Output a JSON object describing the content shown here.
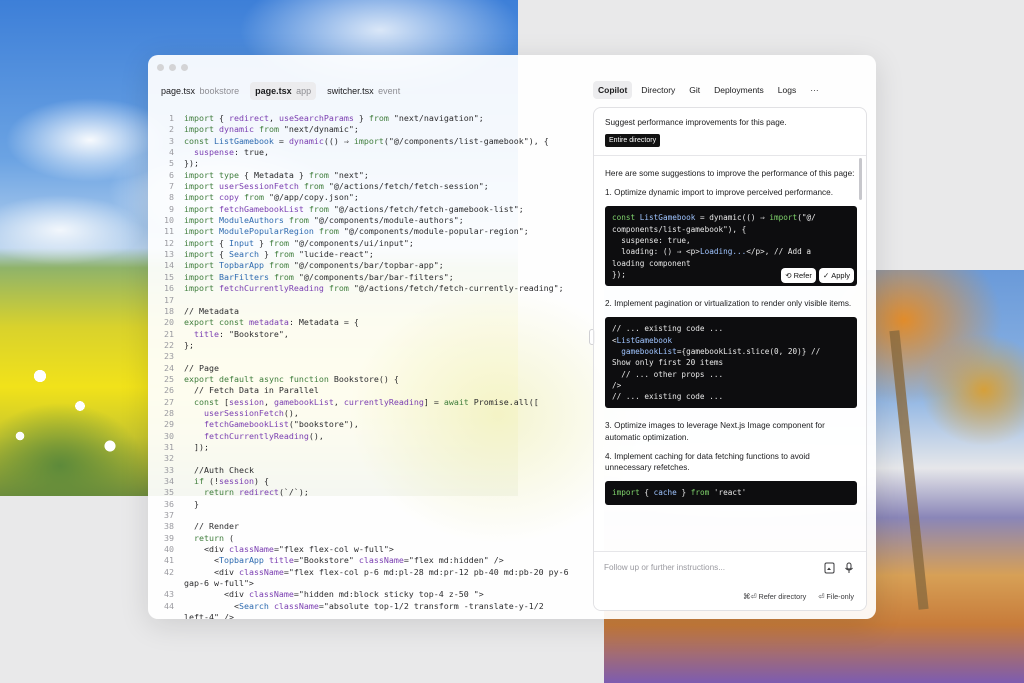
{
  "editor": {
    "tabs": [
      {
        "label": "page.tsx",
        "sub": "bookstore",
        "active": false
      },
      {
        "label": "page.tsx",
        "sub": "app",
        "active": true
      },
      {
        "label": "switcher.tsx",
        "sub": "event",
        "active": false
      }
    ],
    "lines": [
      {
        "n": "1",
        "t": "import { redirect, useSearchParams } from \"next/navigation\";"
      },
      {
        "n": "2",
        "t": "import dynamic from \"next/dynamic\";"
      },
      {
        "n": "3",
        "t": "const ListGamebook = dynamic(() ⇒ import(\"@/components/list-gamebook\"), {"
      },
      {
        "n": "4",
        "t": "  suspense: true,"
      },
      {
        "n": "5",
        "t": "});"
      },
      {
        "n": "6",
        "t": "import type { Metadata } from \"next\";"
      },
      {
        "n": "7",
        "t": "import userSessionFetch from \"@/actions/fetch/fetch-session\";"
      },
      {
        "n": "8",
        "t": "import copy from \"@/app/copy.json\";"
      },
      {
        "n": "9",
        "t": "import fetchGamebookList from \"@/actions/fetch/fetch-gamebook-list\";"
      },
      {
        "n": "10",
        "t": "import ModuleAuthors from \"@/components/module-authors\";"
      },
      {
        "n": "11",
        "t": "import ModulePopularRegion from \"@/components/module-popular-region\";"
      },
      {
        "n": "12",
        "t": "import { Input } from \"@/components/ui/input\";"
      },
      {
        "n": "13",
        "t": "import { Search } from \"lucide-react\";"
      },
      {
        "n": "14",
        "t": "import TopbarApp from \"@/components/bar/topbar-app\";"
      },
      {
        "n": "15",
        "t": "import BarFilters from \"@/components/bar/bar-filters\";"
      },
      {
        "n": "16",
        "t": "import fetchCurrentlyReading from \"@/actions/fetch/fetch-currently-reading\";"
      },
      {
        "n": "17",
        "t": ""
      },
      {
        "n": "18",
        "t": "// Metadata"
      },
      {
        "n": "20",
        "t": "export const metadata: Metadata = {"
      },
      {
        "n": "21",
        "t": "  title: \"Bookstore\","
      },
      {
        "n": "22",
        "t": "};"
      },
      {
        "n": "23",
        "t": ""
      },
      {
        "n": "24",
        "t": "// Page"
      },
      {
        "n": "25",
        "t": "export default async function Bookstore() {"
      },
      {
        "n": "26",
        "t": "  // Fetch Data in Parallel"
      },
      {
        "n": "27",
        "t": "  const [session, gamebookList, currentlyReading] = await Promise.all(["
      },
      {
        "n": "28",
        "t": "    userSessionFetch(),"
      },
      {
        "n": "29",
        "t": "    fetchGamebookList(\"bookstore\"),"
      },
      {
        "n": "30",
        "t": "    fetchCurrentlyReading(),"
      },
      {
        "n": "31",
        "t": "  ]);"
      },
      {
        "n": "32",
        "t": ""
      },
      {
        "n": "33",
        "t": "  //Auth Check"
      },
      {
        "n": "34",
        "t": "  if (!session) {"
      },
      {
        "n": "35",
        "t": "    return redirect(`/`);"
      },
      {
        "n": "36",
        "t": "  }"
      },
      {
        "n": "37",
        "t": ""
      },
      {
        "n": "38",
        "t": "  // Render"
      },
      {
        "n": "39",
        "t": "  return ("
      },
      {
        "n": "40",
        "t": "    <div className=\"flex flex-col w-full\">"
      },
      {
        "n": "41",
        "t": "      <TopbarApp title=\"Bookstore\" className=\"flex md:hidden\" />"
      },
      {
        "n": "42",
        "t": "      <div className=\"flex flex-col p-6 md:pl-28 md:pr-12 pb-40 md:pb-20 py-6"
      },
      {
        "n": "",
        "t": "gap-6 w-full\">"
      },
      {
        "n": "43",
        "t": "        <div className=\"hidden md:block sticky top-4 z-50 \">"
      },
      {
        "n": "44",
        "t": "          <Search className=\"absolute top-1/2 transform -translate-y-1/2"
      },
      {
        "n": "",
        "t": "left-4\" />"
      }
    ]
  },
  "side": {
    "tabs": [
      "Copilot",
      "Directory",
      "Git",
      "Deployments",
      "Logs"
    ],
    "more_label": "···",
    "prompt": "Suggest performance improvements for this page.",
    "scope": "Entire directory",
    "intro": "Here are some suggestions to improve the performance of this page:",
    "s1": "1. Optimize dynamic import to improve perceived performance.",
    "code1": [
      "const ListGamebook = dynamic(() ⇒ import(\"@/",
      "components/list-gamebook\"), {",
      "  suspense: true,",
      "  loading: () ⇒ <p>Loading...</p>, // Add a",
      "loading component",
      "});"
    ],
    "refer_label": "Refer",
    "apply_label": "Apply",
    "s2": "2. Implement pagination or virtualization to render only visible items.",
    "code2": [
      "// ... existing code ...",
      "<ListGamebook",
      "  gamebookList={gamebookList.slice(0, 20)} //",
      "Show only first 20 items",
      "  // ... other props ...",
      "/>",
      "// ... existing code ..."
    ],
    "s3": "3. Optimize images to leverage Next.js Image component for automatic optimization.",
    "s4": "4. Implement caching for data fetching functions to avoid unnecessary refetches.",
    "code3": [
      "import { cache } from 'react'"
    ],
    "input_placeholder": "Follow up or further instructions...",
    "footer_refer": "Refer directory",
    "footer_file": "File-only"
  }
}
